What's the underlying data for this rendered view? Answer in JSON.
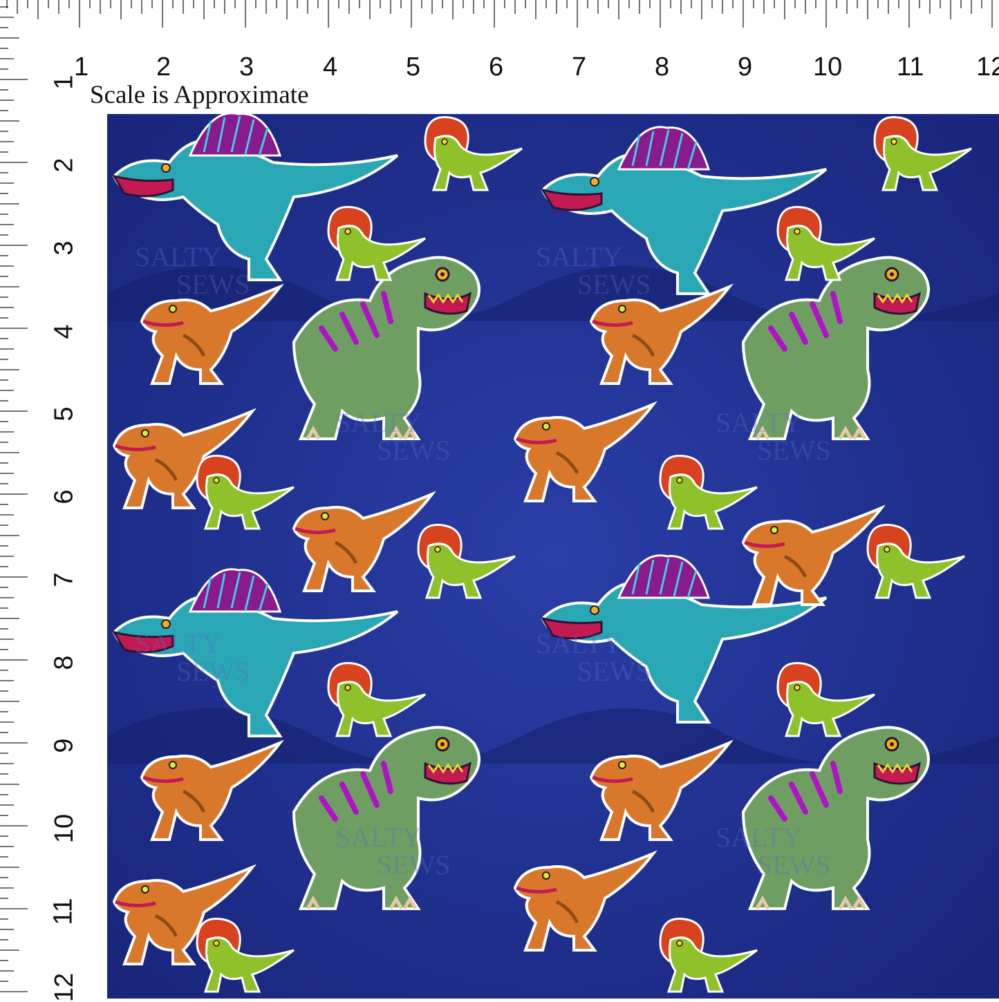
{
  "ruler": {
    "top_numbers": [
      "1",
      "2",
      "3",
      "4",
      "5",
      "6",
      "7",
      "8",
      "9",
      "10",
      "11",
      "12"
    ],
    "left_numbers": [
      "1",
      "2",
      "3",
      "4",
      "5",
      "6",
      "7",
      "8",
      "9",
      "10",
      "11",
      "12"
    ]
  },
  "scale_note": "Scale is Approximate",
  "watermark": {
    "line1": "SALTY",
    "line2": "SEWS"
  },
  "colors": {
    "background_navy": "#1f2f8c",
    "background_dark": "#16226e",
    "trex_green": "#6f9e63",
    "trex_stripe": "#b012c8",
    "spino_teal": "#2aa7b5",
    "spino_sail": "#8b1a8e",
    "raptor_orange": "#d9782a",
    "dilo_green": "#8fc22a",
    "dilo_frill": "#d8421e"
  },
  "icons": [
    "trex-icon",
    "spinosaurus-icon",
    "raptor-icon",
    "dilophosaurus-icon"
  ]
}
